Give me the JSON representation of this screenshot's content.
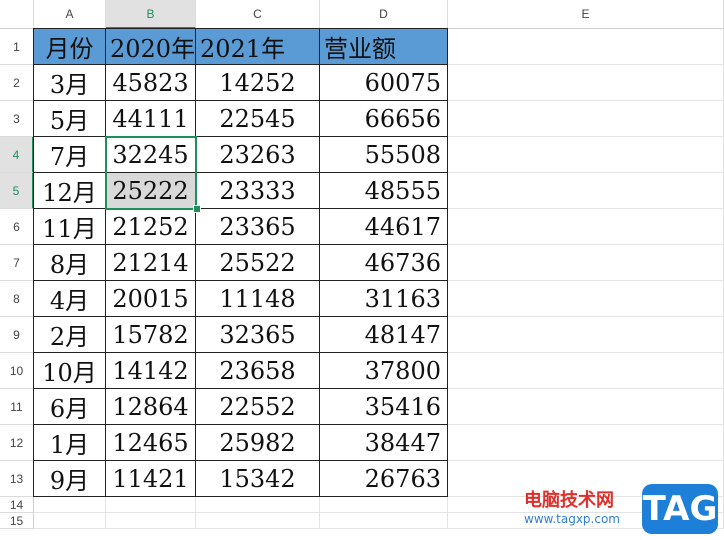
{
  "columns": [
    "A",
    "B",
    "C",
    "D",
    "E"
  ],
  "active_column": "B",
  "active_rows": [
    4,
    5
  ],
  "row_labels": [
    "1",
    "2",
    "3",
    "4",
    "5",
    "6",
    "7",
    "8",
    "9",
    "10",
    "11",
    "12",
    "13",
    "14",
    "15"
  ],
  "table": {
    "headers": [
      "月份",
      "2020年",
      "2021年",
      "营业额"
    ],
    "rows": [
      [
        "3月",
        "45823",
        "14252",
        "60075"
      ],
      [
        "5月",
        "44111",
        "22545",
        "66656"
      ],
      [
        "7月",
        "32245",
        "23263",
        "55508"
      ],
      [
        "12月",
        "25222",
        "23333",
        "48555"
      ],
      [
        "11月",
        "21252",
        "23365",
        "44617"
      ],
      [
        "8月",
        "21214",
        "25522",
        "46736"
      ],
      [
        "4月",
        "20015",
        "11148",
        "31163"
      ],
      [
        "2月",
        "15782",
        "32365",
        "48147"
      ],
      [
        "10月",
        "14142",
        "23658",
        "37800"
      ],
      [
        "6月",
        "12864",
        "22552",
        "35416"
      ],
      [
        "1月",
        "12465",
        "25982",
        "38447"
      ],
      [
        "9月",
        "11421",
        "15342",
        "26763"
      ]
    ]
  },
  "colors": {
    "header_fill": "#5b9bd5",
    "selection": "#1f8f5a",
    "selected_cell_fill": "#d9d9d9"
  },
  "watermark": {
    "line1": "电脑技术网",
    "line2": "www.tagxp.com",
    "badge": "TAG"
  }
}
